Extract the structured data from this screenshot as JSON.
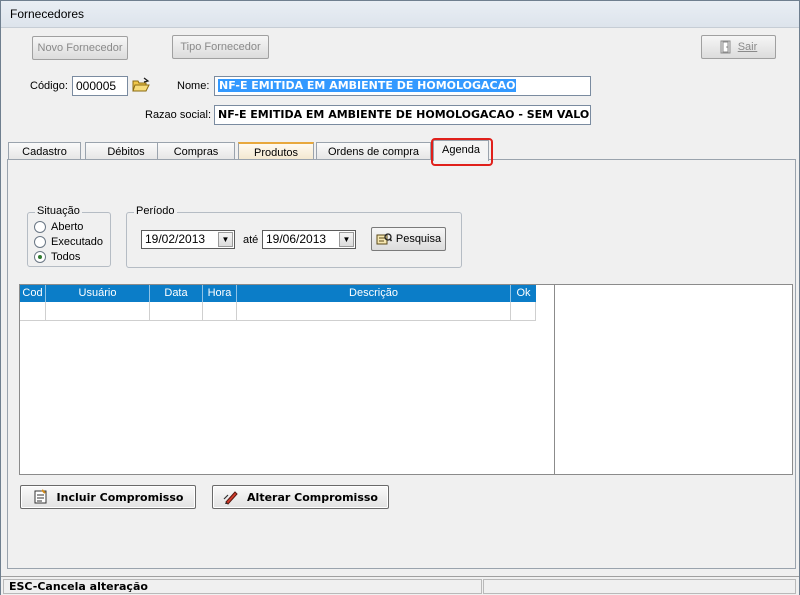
{
  "window": {
    "title": "Fornecedores"
  },
  "toolbar": {
    "novo_label": "Novo Fornecedor",
    "tipo_label": "Tipo Fornecedor",
    "sair_label": "Sair"
  },
  "header": {
    "codigo_label": "Código:",
    "codigo_value": "000005",
    "nome_label": "Nome:",
    "nome_value": "NF-E EMITIDA EM AMBIENTE DE HOMOLOGACAO",
    "razao_label": "Razao social:",
    "razao_value": "NF-E EMITIDA EM AMBIENTE DE HOMOLOGACAO - SEM VALOR"
  },
  "tabs": [
    {
      "label": "Cadastro"
    },
    {
      "label": "Débitos"
    },
    {
      "label": "Compras"
    },
    {
      "label": "Produtos"
    },
    {
      "label": "Ordens de compra"
    },
    {
      "label": "Agenda"
    }
  ],
  "situacao": {
    "title": "Situação",
    "options": [
      {
        "label": "Aberto",
        "checked": false
      },
      {
        "label": "Executado",
        "checked": false
      },
      {
        "label": "Todos",
        "checked": true
      }
    ]
  },
  "periodo": {
    "title": "Período",
    "start": "19/02/2013",
    "ate_label": "até",
    "end": "19/06/2013",
    "search_label": "Pesquisa"
  },
  "grid": {
    "columns": [
      "Cod",
      "Usuário",
      "Data",
      "Hora",
      "Descrição",
      "Ok"
    ],
    "rows": []
  },
  "actions": {
    "incluir_label": "Incluir Compromisso",
    "alterar_label": "Alterar Compromisso"
  },
  "status": {
    "text": "ESC-Cancela alteração"
  },
  "colors": {
    "grid_header": "#0b7dc8",
    "selection": "#3399ff",
    "highlight": "#e0201b",
    "tab_hot": "#e8a83c"
  }
}
